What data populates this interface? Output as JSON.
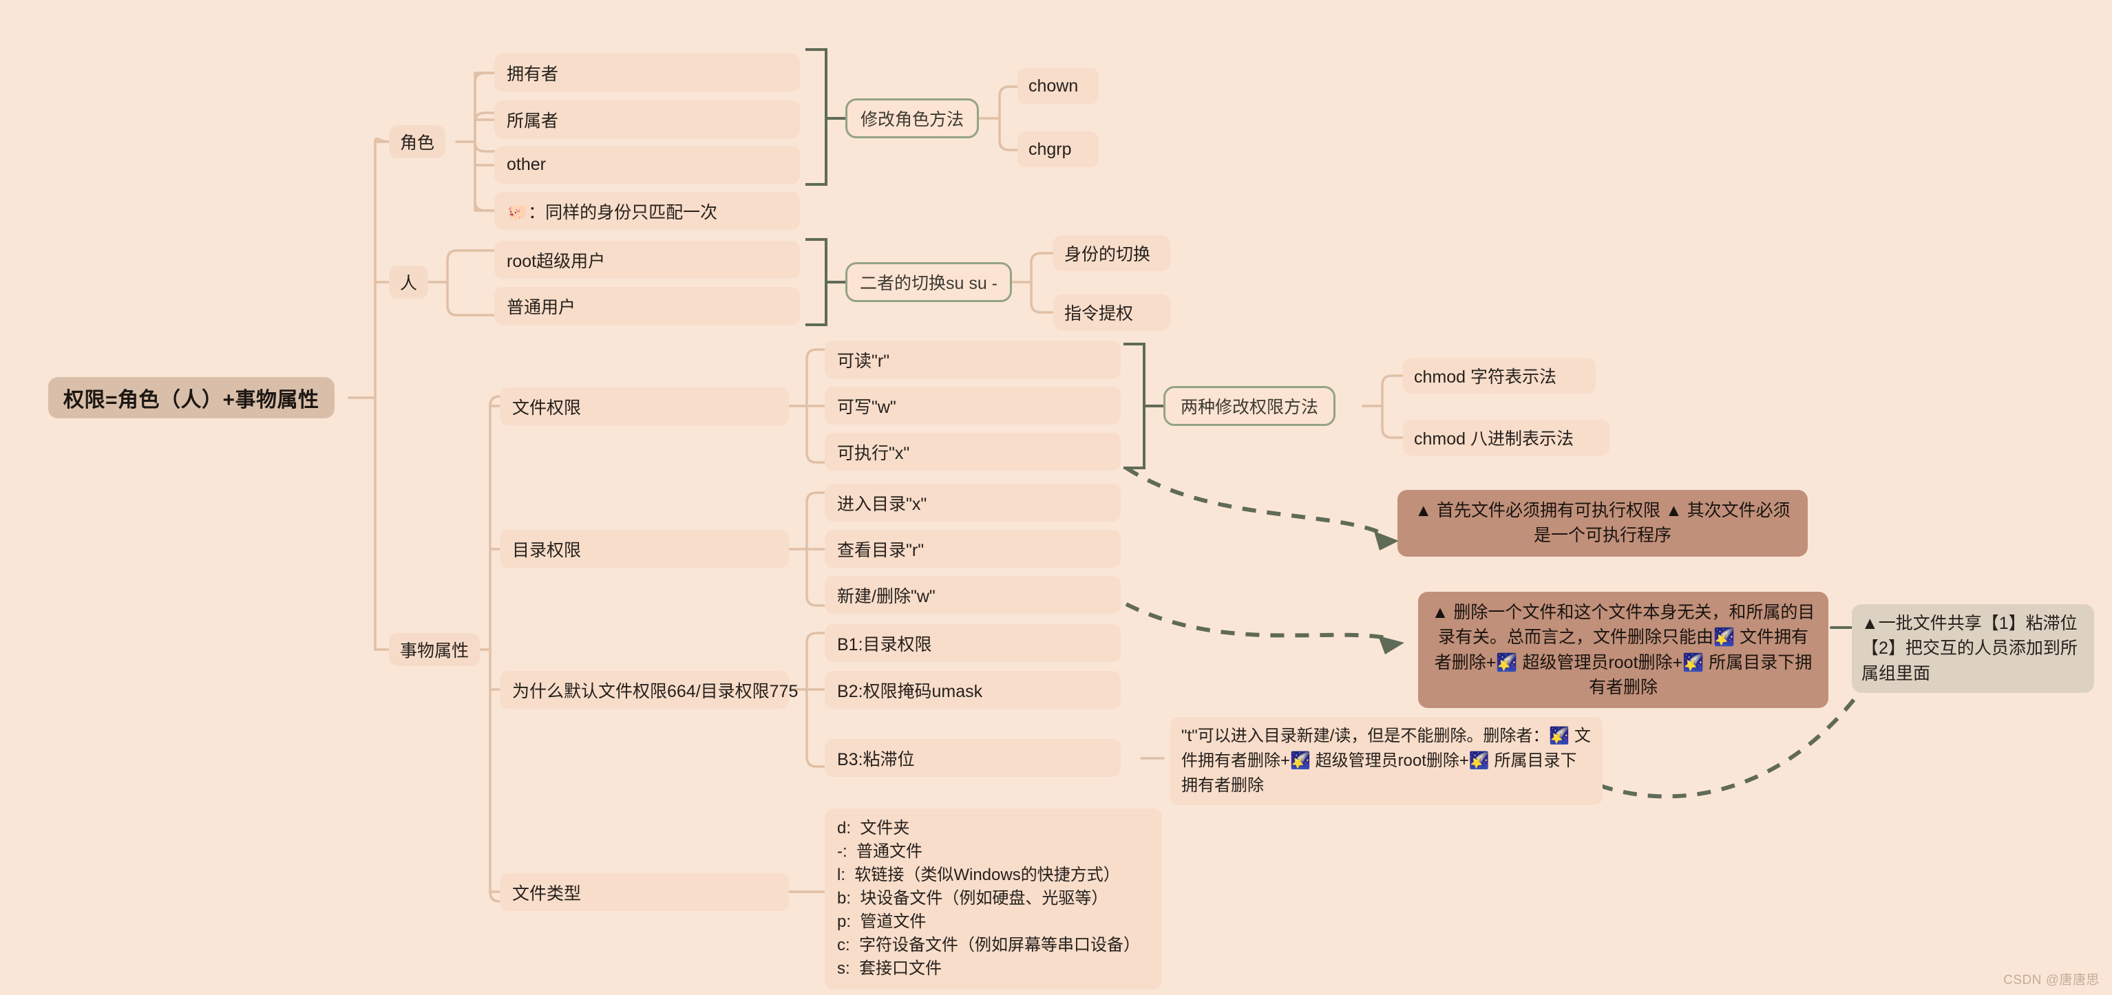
{
  "root": {
    "label": "权限=角色（人）+事物属性"
  },
  "branches": {
    "role": {
      "label": "角色",
      "items": [
        {
          "label": "拥有者"
        },
        {
          "label": "所属者"
        },
        {
          "label": "other"
        }
      ],
      "note": "🐖：同样的身份只匹配一次",
      "method": {
        "label": "修改角色方法",
        "children": [
          {
            "label": "chown"
          },
          {
            "label": "chgrp"
          }
        ]
      }
    },
    "person": {
      "label": "人",
      "items": [
        {
          "label": "root超级用户"
        },
        {
          "label": "普通用户"
        }
      ],
      "method": {
        "label": "二者的切换su su -",
        "children": [
          {
            "label": "身份的切换"
          },
          {
            "label": "指令提权"
          }
        ]
      }
    },
    "attributes": {
      "label": "事物属性",
      "groups": [
        {
          "label": "文件权限",
          "items": [
            {
              "label": "可读\"r\""
            },
            {
              "label": "可写\"w\""
            },
            {
              "label": "可执行\"x\""
            }
          ],
          "method": {
            "label": "两种修改权限方法",
            "children": [
              {
                "label": "chmod 字符表示法"
              },
              {
                "label": "chmod  八进制表示法"
              }
            ]
          }
        },
        {
          "label": "目录权限",
          "items": [
            {
              "label": "进入目录\"x\""
            },
            {
              "label": "查看目录\"r\""
            },
            {
              "label": "新建/删除\"w\""
            }
          ]
        },
        {
          "label": "为什么默认文件权限664/目录权限775",
          "items": [
            {
              "label": "B1:目录权限"
            },
            {
              "label": "B2:权限掩码umask"
            },
            {
              "label": "B3:粘滞位"
            }
          ]
        },
        {
          "label": "文件类型",
          "lines": "d:  文件夹\n-:  普通文件\nl:  软链接（类似Windows的快捷方式）\nb:  块设备文件（例如硬盘、光驱等）\np:  管道文件\nc:  字符设备文件（例如屏幕等串口设备）\ns:  套接口文件"
        }
      ]
    }
  },
  "callouts": {
    "exec": "▲ 首先文件必须拥有可执行权限 ▲ 其次文件必须须是一个可执行程序",
    "exec_display": "▲ 首先文件必须拥有可执行权限  ▲ 其次文件必须是一个可执行程序",
    "delete": "▲ 删除一个文件和这个文件本身无关，和所属的目录有关。总而言之，文件删除只能由🌠 文件拥有者删除+🌠 超级管理员root删除+🌠 所属目录下拥有者删除",
    "sticky": "\"t\"可以进入目录新建/读，但是不能删除。删除者：🌠 文件拥有者删除+🌠 超级管理员root删除+🌠 所属目录下拥有者删除",
    "share": "▲一批文件共享【1】粘滞位【2】把交互的人员添加到所属组里面"
  },
  "watermark": "CSDN @唐唐思",
  "colors": {
    "background": "#fae6d7",
    "root_bg": "#d9bfaa",
    "node_bg": "#f7ddca",
    "green_border": "#93a384",
    "callout_bg": "#c1907a",
    "grey_box_bg": "#ddd2c2",
    "arrow": "#5f6b57",
    "link": "#e0c0a6",
    "accent_triangle": "#ef2d1e"
  }
}
